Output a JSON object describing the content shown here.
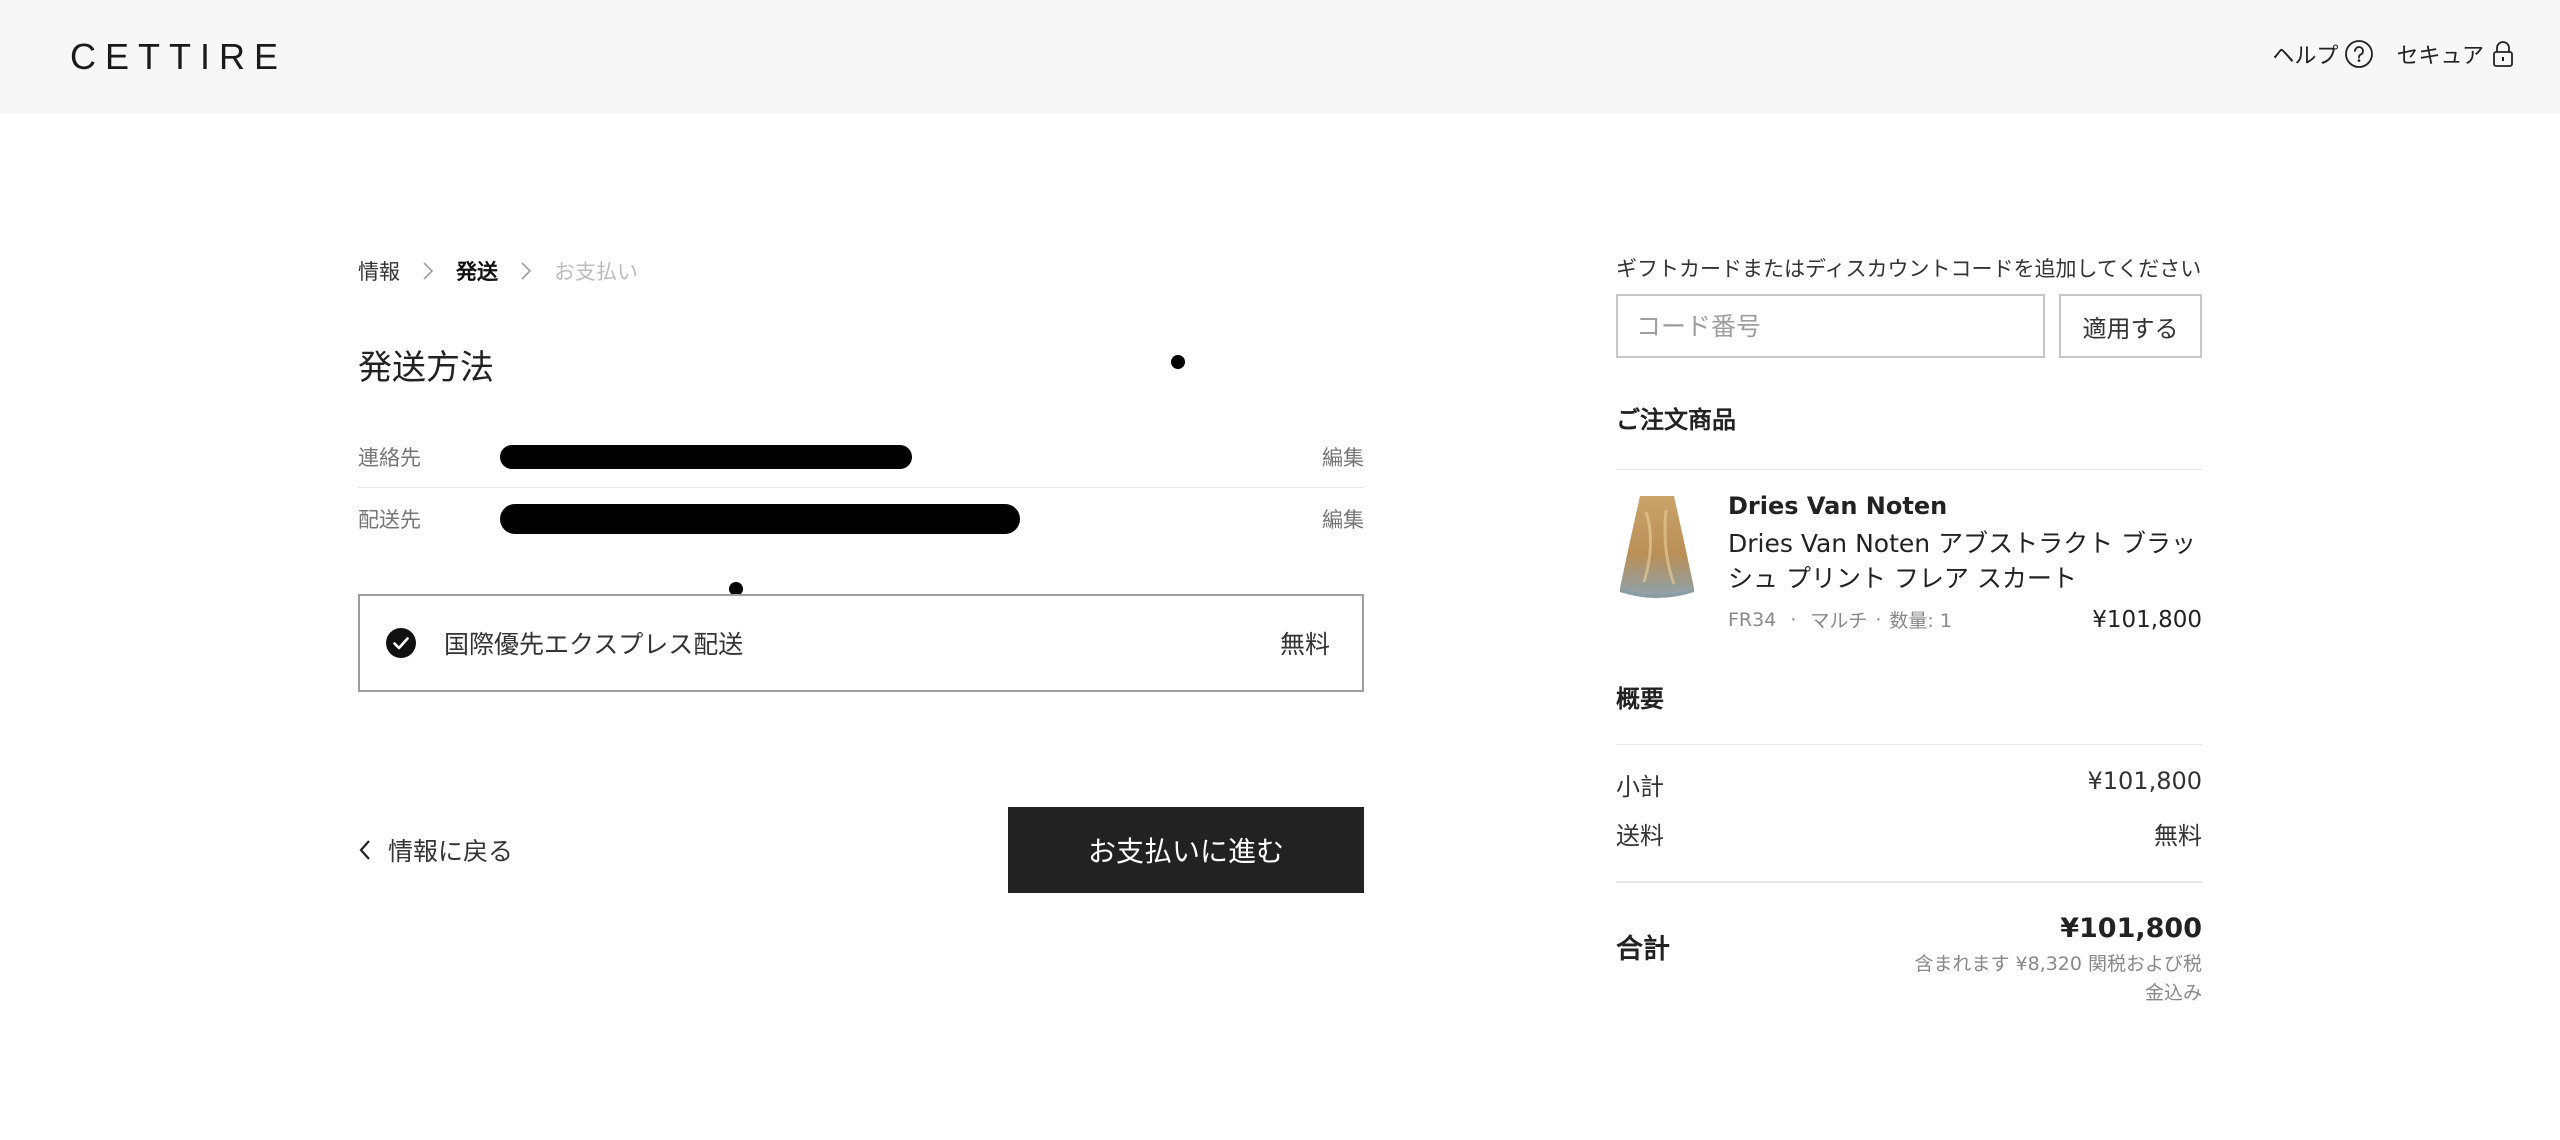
{
  "header": {
    "logo": "CETTIRE",
    "help_label": "ヘルプ",
    "secure_label": "セキュア"
  },
  "breadcrumb": {
    "items": [
      {
        "label": "情報",
        "state": "done"
      },
      {
        "label": "発送",
        "state": "current"
      },
      {
        "label": "お支払い",
        "state": "disabled"
      }
    ]
  },
  "main": {
    "title": "発送方法",
    "contact": {
      "label": "連絡先",
      "edit": "編集"
    },
    "shipto": {
      "label": "配送先",
      "edit": "編集"
    },
    "shipping_option": {
      "name": "国際優先エクスプレス配送",
      "price": "無料"
    },
    "back_label": "情報に戻る",
    "continue_label": "お支払いに進む"
  },
  "sidebar": {
    "gift_label": "ギフトカードまたはディスカウントコードを追加してください",
    "code_placeholder": "コード番号",
    "apply_label": "適用する",
    "order_title": "ご注文商品",
    "product": {
      "brand": "Dries Van Noten",
      "name": "Dries Van Noten アブストラクト ブラッシュ プリント フレア スカート",
      "size": "FR34",
      "color": "マルチ",
      "qty": "数量: 1",
      "price": "¥101,800"
    },
    "summary_title": "概要",
    "subtotal_label": "小計",
    "subtotal_value": "¥101,800",
    "shipping_label": "送料",
    "shipping_value": "無料",
    "total_label": "合計",
    "total_value": "¥101,800",
    "tax_note": "含まれます ¥8,320 関税および税金込み"
  },
  "colors": {
    "button_dark": "#222222",
    "header_bg": "#f7f7f7",
    "muted_text": "#757575"
  }
}
